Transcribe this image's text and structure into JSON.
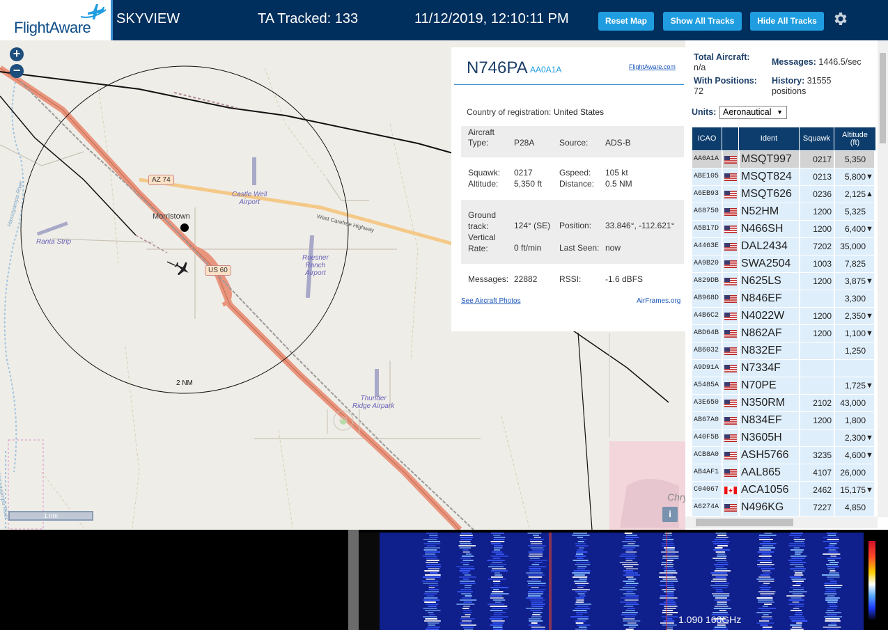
{
  "header": {
    "logo_text": "FlightAware",
    "app_name": "SKYVIEW",
    "tracked": "TA Tracked: 133",
    "datetime": "11/12/2019, 12:10:11 PM",
    "reset_map": "Reset Map",
    "show_all": "Show All Tracks",
    "hide_all": "Hide All Tracks"
  },
  "map": {
    "zoom_in": "+",
    "zoom_out": "−",
    "labels": {
      "castle_well": "Castle Well\nAirport",
      "ranta": "Ranta Strip",
      "roesner": "Roesner\nRanch\nAirport",
      "thunder": "Thunder\nRidge Airpark",
      "morristown": "Morristown",
      "carefree": "West Carefree Highway",
      "river1": "Hassayampa River",
      "river2": "Hassayampa River",
      "chr": "Chry",
      "ring": "2 NM"
    },
    "shields": {
      "az74": "AZ 74",
      "us60": "US 60"
    },
    "scale": "1 nm",
    "info": "i"
  },
  "aircraft": {
    "ident": "N746PA",
    "icao": "AA0A1A",
    "flightaware_link": "FlightAware.com",
    "country_label": "Country of registration:",
    "country": "United States",
    "type_label": "Aircraft\nType:",
    "type": "P28A",
    "source_label": "Source:",
    "source": "ADS-B",
    "squawk_label": "Squawk:",
    "squawk": "0217",
    "altitude_label": "Altitude:",
    "altitude": "5,350 ft",
    "gspeed_label": "Gspeed:",
    "gspeed": "105 kt",
    "distance_label": "Distance:",
    "distance": "0.5 NM",
    "track_label": "Ground\ntrack:",
    "track": "124° (SE)",
    "vrate_label": "Vertical\nRate:",
    "vrate": "0 ft/min",
    "position_label": "Position:",
    "position": "33.846°, -112.621°",
    "lastseen_label": "Last Seen:",
    "lastseen": "now",
    "messages_label": "Messages:",
    "messages": "22882",
    "rssi_label": "RSSI:",
    "rssi": "-1.6 dBFS",
    "photos_link": "See Aircraft Photos",
    "airframes_link": "AirFrames.org"
  },
  "stats": {
    "total_label": "Total Aircraft:",
    "total": "n/a",
    "withpos_label": "With Positions:",
    "withpos": "72",
    "messages_label": "Messages:",
    "messages": "1446.5/sec",
    "history_label": "History:",
    "history": "31555\npositions",
    "units_label": "Units:",
    "units": "Aeronautical"
  },
  "table": {
    "headers": {
      "icao": "ICAO",
      "ident": "Ident",
      "squawk": "Squawk",
      "altitude": "Altitude\n(ft)"
    },
    "rows": [
      {
        "icao": "AA0A1A",
        "flag": "us",
        "ident": "MSQT997",
        "squawk": "0217",
        "alt": "5,350",
        "arrow": ""
      },
      {
        "icao": "ABE105",
        "flag": "us",
        "ident": "MSQT824",
        "squawk": "0213",
        "alt": "5,800",
        "arrow": "▼"
      },
      {
        "icao": "A6EB93",
        "flag": "us",
        "ident": "MSQT626",
        "squawk": "0236",
        "alt": "2,125",
        "arrow": "▲"
      },
      {
        "icao": "A68750",
        "flag": "us",
        "ident": "N52HM",
        "squawk": "1200",
        "alt": "5,325",
        "arrow": ""
      },
      {
        "icao": "A5B17D",
        "flag": "us",
        "ident": "N466SH",
        "squawk": "1200",
        "alt": "6,400",
        "arrow": "▼"
      },
      {
        "icao": "A4463E",
        "flag": "us",
        "ident": "DAL2434",
        "squawk": "7202",
        "alt": "35,000",
        "arrow": ""
      },
      {
        "icao": "AA9B20",
        "flag": "us",
        "ident": "SWA2504",
        "squawk": "1003",
        "alt": "7,825",
        "arrow": ""
      },
      {
        "icao": "A829DB",
        "flag": "us",
        "ident": "N625LS",
        "squawk": "1200",
        "alt": "3,875",
        "arrow": "▼"
      },
      {
        "icao": "AB968D",
        "flag": "us",
        "ident": "N846EF",
        "squawk": "",
        "alt": "3,300",
        "arrow": ""
      },
      {
        "icao": "A4B6C2",
        "flag": "us",
        "ident": "N4022W",
        "squawk": "1200",
        "alt": "2,350",
        "arrow": "▼"
      },
      {
        "icao": "ABD64B",
        "flag": "us",
        "ident": "N862AF",
        "squawk": "1200",
        "alt": "1,100",
        "arrow": "▼"
      },
      {
        "icao": "AB6032",
        "flag": "us",
        "ident": "N832EF",
        "squawk": "",
        "alt": "1,250",
        "arrow": ""
      },
      {
        "icao": "A9D91A",
        "flag": "us",
        "ident": "N7334F",
        "squawk": "",
        "alt": "",
        "arrow": ""
      },
      {
        "icao": "A5485A",
        "flag": "us",
        "ident": "N70PE",
        "squawk": "",
        "alt": "1,725",
        "arrow": "▼"
      },
      {
        "icao": "A3E650",
        "flag": "us",
        "ident": "N350RM",
        "squawk": "2102",
        "alt": "43,000",
        "arrow": ""
      },
      {
        "icao": "AB67A0",
        "flag": "us",
        "ident": "N834EF",
        "squawk": "1200",
        "alt": "1,800",
        "arrow": ""
      },
      {
        "icao": "A40F5B",
        "flag": "us",
        "ident": "N3605H",
        "squawk": "",
        "alt": "2,300",
        "arrow": "▼"
      },
      {
        "icao": "ACB8A0",
        "flag": "us",
        "ident": "ASH5766",
        "squawk": "3235",
        "alt": "4,600",
        "arrow": "▼"
      },
      {
        "icao": "AB4AF1",
        "flag": "us",
        "ident": "AAL865",
        "squawk": "4107",
        "alt": "26,000",
        "arrow": ""
      },
      {
        "icao": "C04067",
        "flag": "ca",
        "ident": "ACA1056",
        "squawk": "2462",
        "alt": "15,175",
        "arrow": "▼"
      },
      {
        "icao": "A6274A",
        "flag": "us",
        "ident": "N496KG",
        "squawk": "7227",
        "alt": "4,850",
        "arrow": ""
      }
    ]
  },
  "spectrum": {
    "frequency": "1.090 160GHz"
  },
  "colors": {
    "header": "#002f5d",
    "button": "#1f9de0",
    "table_header": "#0c3d6d",
    "row_alt": "#dfeefb",
    "selected": "#d3d3d3"
  }
}
